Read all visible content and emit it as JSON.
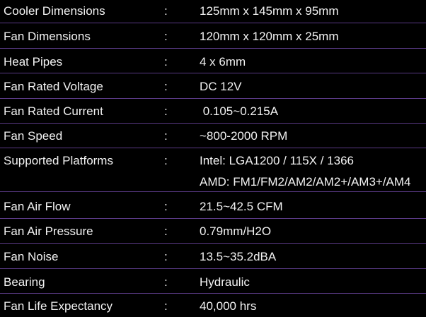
{
  "colors": {
    "background": "#000000",
    "text": "#f2f2f2",
    "divider": "#5a3a86"
  },
  "separator": ":",
  "specs": [
    {
      "label": "Cooler Dimensions",
      "value": "125mm x 145mm x 95mm"
    },
    {
      "label": "Fan Dimensions",
      "value": "120mm x 120mm x 25mm"
    },
    {
      "label": "Heat Pipes",
      "value": "4 x 6mm"
    },
    {
      "label": "Fan Rated Voltage",
      "value": "DC 12V"
    },
    {
      "label": "Fan Rated Current",
      "value": " 0.105~0.215A"
    },
    {
      "label": "Fan Speed",
      "value": "~800-2000 RPM"
    },
    {
      "label": "Supported Platforms",
      "value": "Intel: LGA1200 / 115X / 1366",
      "value2": "AMD: FM1/FM2/AM2/AM2+/AM3+/AM4"
    },
    {
      "label": "Fan Air Flow",
      "value": "21.5~42.5 CFM"
    },
    {
      "label": "Fan Air Pressure",
      "value": "0.79mm/H2O"
    },
    {
      "label": "Fan Noise",
      "value": "13.5~35.2dBA"
    },
    {
      "label": "Bearing",
      "value": "Hydraulic"
    },
    {
      "label": "Fan Life Expectancy",
      "value": "40,000 hrs"
    }
  ]
}
